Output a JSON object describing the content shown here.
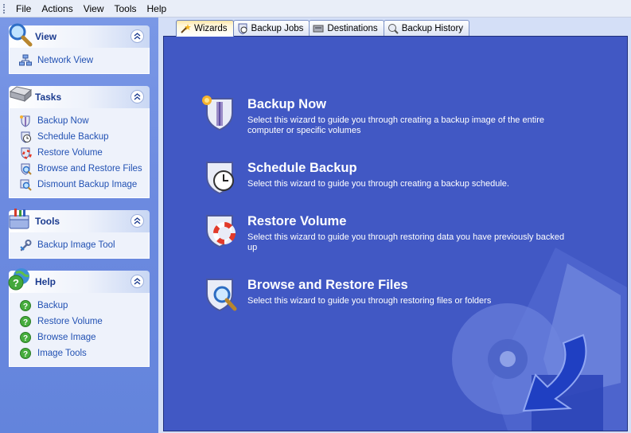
{
  "menu": [
    "File",
    "Actions",
    "View",
    "Tools",
    "Help"
  ],
  "sidebar": {
    "view": {
      "title": "View",
      "items": [
        "Network View"
      ]
    },
    "tasks": {
      "title": "Tasks",
      "items": [
        "Backup Now",
        "Schedule Backup",
        "Restore Volume",
        "Browse and Restore Files",
        "Dismount Backup Image"
      ]
    },
    "tools": {
      "title": "Tools",
      "items": [
        "Backup Image Tool"
      ]
    },
    "help": {
      "title": "Help",
      "items": [
        "Backup",
        "Restore Volume",
        "Browse Image",
        "Image Tools"
      ]
    }
  },
  "tabs": [
    {
      "label": "Wizards",
      "active": true
    },
    {
      "label": "Backup Jobs",
      "active": false
    },
    {
      "label": "Destinations",
      "active": false
    },
    {
      "label": "Backup History",
      "active": false
    }
  ],
  "wizards": [
    {
      "title": "Backup Now",
      "description": "Select this wizard to guide you through creating a backup image of the entire computer or specific volumes"
    },
    {
      "title": "Schedule Backup",
      "description": "Select this wizard to guide you through creating a backup schedule."
    },
    {
      "title": "Restore Volume",
      "description": "Select this wizard to guide you through restoring data you have previously backed up"
    },
    {
      "title": "Browse and Restore Files",
      "description": "Select this wizard to guide you through restoring files or folders"
    }
  ],
  "colors": {
    "content_bg": "#4158c4",
    "pane_bg": "#6d8be0",
    "link": "#2251b3",
    "header_title": "#1b3b8f"
  }
}
